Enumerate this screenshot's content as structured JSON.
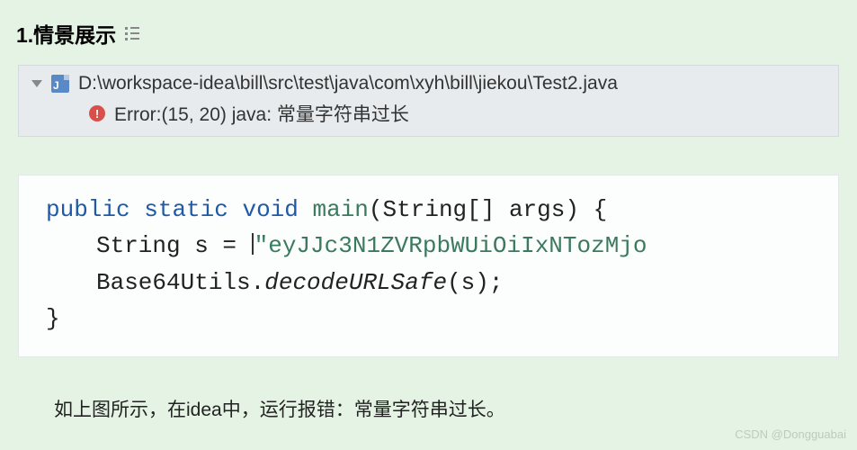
{
  "heading": {
    "text": "1.情景展示"
  },
  "errorPanel": {
    "filePath": "D:\\workspace-idea\\bill\\src\\test\\java\\com\\xyh\\bill\\jiekou\\Test2.java",
    "errorBadge": "!",
    "errorText": "Error:(15, 20) java: 常量字符串过长"
  },
  "code": {
    "kw_public": "public",
    "kw_static": "static",
    "kw_void": "void",
    "method_main": "main",
    "paren_open": "(",
    "param_type": "String[] args",
    "paren_close_brace": ") {",
    "line2_prefix": "String s = ",
    "line2_string": "\"eyJJc3N1ZVRpbWUiOiIxNTozMjo",
    "line3_prefix": "Base64Utils.",
    "line3_call": "decodeURLSafe",
    "line3_args": "(s);",
    "line4": "}"
  },
  "caption": "如上图所示，在idea中，运行报错：常量字符串过长。",
  "watermark": "CSDN @Dongguabai"
}
